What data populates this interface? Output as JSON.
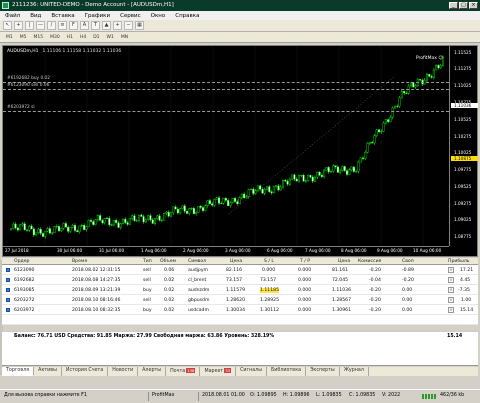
{
  "window": {
    "title": "2111236: UNITED-DEMO - Demo Account - [AUDUSDm,H1]",
    "min": "_",
    "max": "□",
    "close": "×"
  },
  "menu": [
    "Файл",
    "Вид",
    "Вставка",
    "Графики",
    "Сервис",
    "Окно",
    "Справка"
  ],
  "toolbar_timeframes": [
    "M1",
    "M5",
    "M15",
    "M30",
    "H1",
    "H4",
    "D1",
    "W1",
    "MN"
  ],
  "chart": {
    "symbol": "AUDUSDm,H1",
    "ohlc": "1.11106 1.11158 1.11032 1.11036",
    "expert": "ProfitMax ☺",
    "order_lines": [
      {
        "label": "#6192682 buy 0.02",
        "price": 1.1109
      },
      {
        "label": "#6123090 sell 0.06",
        "price": 1.10983
      },
      {
        "label": "#6203972 sl",
        "price": 1.10665
      }
    ],
    "price_ticks": [
      "1.11525",
      "1.11275",
      "1.11025",
      "1.10775",
      "1.10525",
      "1.10275",
      "1.10025",
      "1.09775",
      "1.09525",
      "1.09275",
      "1.09025",
      "1.08775"
    ],
    "price_boxes": [
      {
        "text": "1.11036",
        "color": "#ffffff"
      },
      {
        "text": "1.10875",
        "color": "#ffdd00"
      }
    ],
    "time_labels": [
      "27 Jul 2018",
      "30 Jul 06:00",
      "31 Jul 06:00",
      "1 Aug 06:00",
      "2 Aug 06:00",
      "3 Aug 06:00",
      "6 Aug 06:00",
      "7 Aug 06:00",
      "8 Aug 06:00",
      "9 Aug 06:00",
      "10 Aug 06:00"
    ]
  },
  "trade_table": {
    "headers": [
      "Ордер",
      "Время",
      "Тип",
      "Объем",
      "Символ",
      "Цена",
      "S / L",
      "T / P",
      "Цена",
      "Комиссия",
      "Своп",
      "Прибыль"
    ],
    "rows": [
      [
        "6123090",
        "2018.08.02 12:31:15",
        "sell",
        "0.06",
        "audjpym",
        "82.116",
        "0.000",
        "0.000",
        "81.161",
        "-0.20",
        "-0.89",
        "17.21"
      ],
      [
        "6192682",
        "2018.08.08 14:27:35",
        "sell",
        "0.02",
        "cl_brent",
        "73.157",
        "73.157",
        "0.000",
        "72.045",
        "-0.04",
        "-0.20",
        "4.45"
      ],
      [
        "6193085",
        "2018.08.09 13:21:39",
        "buy",
        "0.02",
        "audnzdm",
        "1.11579",
        "1.11185",
        "0.000",
        "1.11036",
        "-0.20",
        "0.00",
        "-7.35"
      ],
      [
        "6203272",
        "2018.08.10 08:16:46",
        "sell",
        "0.02",
        "gbpusdm",
        "1.28620",
        "1.28925",
        "0.000",
        "1.28567",
        "-0.20",
        "0.00",
        "1.00"
      ],
      [
        "6203972",
        "2018.08.10 08:32:35",
        "buy",
        "0.02",
        "usdcadm",
        "1.30034",
        "1.30112",
        "0.000",
        "1.30961",
        "-0.20",
        "0.00",
        "15.14"
      ]
    ],
    "balance_text": "Баланс: 76.71 USD  Средства: 91.85  Маржа: 27.99  Свободная маржа: 63.86  Уровень: 328.19%",
    "balance_total": "15.14"
  },
  "tabs": [
    "Торговля",
    "Активы",
    "История Счета",
    "Новости",
    "Алерты",
    "Почта",
    "Маркет",
    "Сигналы",
    "Библиотека",
    "Эксперты",
    "Журнал"
  ],
  "mail_badge": "138",
  "market_badge": "33",
  "status": {
    "help": "Для вызова справки нажмите F1",
    "profile": "ProfitMax",
    "datetime": "2018.08.01 01:00",
    "o": "O: 1.09895",
    "h": "H: 1.09896",
    "l": "L: 1.09835",
    "c": "C: 1.09835",
    "v": "V: 2022",
    "traffic": "462/36 kb"
  },
  "chart_data": {
    "type": "line",
    "title": "AUDUSDm,H1",
    "xlabel": "",
    "ylabel": "",
    "x": [
      "27 Jul 2018",
      "30 Jul 06:00",
      "31 Jul 06:00",
      "1 Aug 06:00",
      "2 Aug 06:00",
      "3 Aug 06:00",
      "6 Aug 06:00",
      "7 Aug 06:00",
      "8 Aug 06:00",
      "9 Aug 06:00",
      "10 Aug 06:00"
    ],
    "ylim": [
      1.0865,
      1.1163
    ],
    "series": [
      {
        "values": [
          1.0891,
          1.0887,
          1.0901,
          1.0903,
          1.0918,
          1.0932,
          1.0952,
          1.0971,
          1.0983,
          1.1086,
          1.1139
        ]
      }
    ]
  }
}
